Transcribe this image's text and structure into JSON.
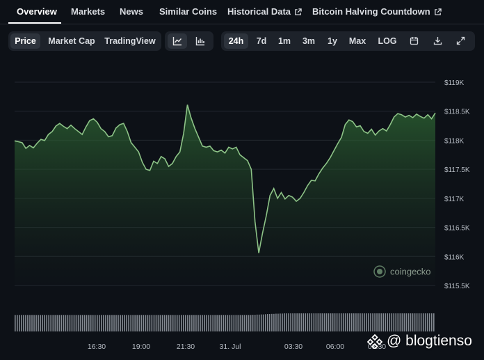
{
  "nav": {
    "tabs": [
      {
        "label": "Overview",
        "active": true,
        "external": false
      },
      {
        "label": "Markets",
        "active": false,
        "external": false
      },
      {
        "label": "News",
        "active": false,
        "external": false
      },
      {
        "label": "Similar Coins",
        "active": false,
        "external": false
      },
      {
        "label": "Historical Data",
        "active": false,
        "external": true
      },
      {
        "label": "Bitcoin Halving Countdown",
        "active": false,
        "external": true
      }
    ]
  },
  "toolbar": {
    "metric_tabs": [
      "Price",
      "Market Cap",
      "TradingView"
    ],
    "metric_selected": "Price",
    "chart_type_icons": [
      "line-chart-icon",
      "bar-chart-icon"
    ],
    "chart_type_selected": "line-chart-icon",
    "ranges": [
      "24h",
      "7d",
      "1m",
      "3m",
      "1y",
      "Max",
      "LOG"
    ],
    "range_selected": "24h",
    "action_icons": [
      "calendar-icon",
      "download-icon",
      "expand-icon"
    ]
  },
  "chart_data": {
    "type": "area",
    "x": [
      "14:05",
      "14:18",
      "14:30",
      "14:43",
      "14:55",
      "15:08",
      "15:20",
      "15:33",
      "15:45",
      "15:58",
      "16:10",
      "16:23",
      "16:35",
      "16:48",
      "17:00",
      "17:13",
      "17:25",
      "17:38",
      "17:50",
      "18:03",
      "18:15",
      "18:28",
      "18:40",
      "18:53",
      "19:05",
      "19:18",
      "19:30",
      "19:43",
      "19:55",
      "20:08",
      "20:20",
      "20:33",
      "20:45",
      "20:58",
      "21:10",
      "21:23",
      "21:35",
      "21:48",
      "22:00",
      "22:13",
      "22:25",
      "22:38",
      "22:50",
      "23:03",
      "23:15",
      "23:28",
      "23:40",
      "23:53",
      "00:05",
      "00:18",
      "00:30",
      "00:43",
      "00:55",
      "01:08",
      "01:20",
      "01:33",
      "01:45",
      "01:58",
      "02:10",
      "02:23",
      "02:35",
      "02:48",
      "03:00",
      "03:13",
      "03:25",
      "03:38",
      "03:50",
      "04:03",
      "04:15",
      "04:28",
      "04:40",
      "04:53",
      "05:05",
      "05:18",
      "05:30",
      "05:43",
      "05:55",
      "06:08",
      "06:20",
      "06:33",
      "06:45",
      "06:58",
      "07:10",
      "07:23",
      "07:35",
      "07:48",
      "08:00",
      "08:13",
      "08:25",
      "08:38",
      "08:50",
      "09:03",
      "09:15",
      "09:28",
      "09:40",
      "09:53",
      "10:05",
      "10:18",
      "10:30",
      "10:43",
      "10:55",
      "11:08",
      "11:20",
      "11:33"
    ],
    "values": [
      117990,
      117975,
      117960,
      117860,
      117910,
      117870,
      117950,
      118015,
      117995,
      118100,
      118150,
      118245,
      118290,
      118240,
      118200,
      118260,
      118200,
      118150,
      118100,
      118230,
      118340,
      118370,
      118310,
      118200,
      118150,
      118060,
      118080,
      118210,
      118270,
      118290,
      118150,
      117960,
      117880,
      117800,
      117620,
      117500,
      117480,
      117640,
      117600,
      117720,
      117680,
      117550,
      117600,
      117720,
      117800,
      118120,
      118610,
      118380,
      118200,
      118050,
      117900,
      117880,
      117900,
      117820,
      117800,
      117830,
      117780,
      117880,
      117850,
      117880,
      117750,
      117700,
      117650,
      117500,
      116600,
      116060,
      116400,
      116700,
      117050,
      117170,
      117000,
      117100,
      116990,
      117050,
      117020,
      116950,
      117000,
      117100,
      117220,
      117310,
      117300,
      117420,
      117520,
      117600,
      117700,
      117820,
      117940,
      118050,
      118270,
      118350,
      118320,
      118230,
      118250,
      118150,
      118120,
      118190,
      118090,
      118160,
      118200,
      118160,
      118270,
      118400,
      118460,
      118440,
      118400,
      118430,
      118390,
      118450,
      118410,
      118380,
      118440,
      118370,
      118470
    ],
    "ylim": [
      115500,
      119000
    ],
    "y_ticks": [
      "$119K",
      "$118.5K",
      "$118K",
      "$117.5K",
      "$117K",
      "$116.5K",
      "$116K",
      "$115.5K"
    ],
    "x_ticks": [
      "16:30",
      "19:00",
      "21:30",
      "31. Jul",
      "03:30",
      "06:00",
      "08:30"
    ],
    "volume": [
      0.91,
      0.91,
      0.91,
      0.91,
      0.91,
      0.91,
      0.91,
      0.91,
      0.91,
      0.91,
      0.91,
      0.91,
      0.91,
      0.91,
      0.91,
      0.91,
      0.91,
      0.91,
      0.91,
      0.91,
      0.91,
      0.91,
      0.91,
      0.91,
      0.91,
      0.91,
      0.91,
      0.91,
      0.91,
      0.91,
      0.91,
      0.91,
      0.91,
      0.91,
      0.91,
      0.91,
      0.91,
      0.91,
      0.91,
      0.91,
      0.91,
      0.91,
      0.91,
      0.91,
      0.91,
      0.91,
      0.91,
      0.91,
      0.91,
      0.91,
      0.91,
      0.91,
      0.91,
      0.91,
      0.91,
      0.91,
      0.91,
      0.91,
      0.91,
      0.91,
      0.91,
      0.91,
      0.91,
      0.91,
      0.92,
      0.93,
      0.94,
      0.95,
      0.96,
      0.97,
      0.98,
      0.99,
      1,
      1,
      1,
      1,
      1,
      1,
      1,
      1,
      1,
      1,
      1,
      1,
      1,
      1,
      1,
      1,
      1,
      1,
      1,
      1,
      1,
      1,
      1,
      1,
      1,
      1,
      1,
      1,
      1,
      1,
      1,
      1,
      1,
      1,
      1,
      1,
      1,
      1,
      1,
      1,
      1
    ],
    "line_color": "#8dc387",
    "volume_color": "#9aa0a8",
    "grid": true
  },
  "branding": {
    "chart_watermark": "coingecko",
    "overlay_text": "@ blogtienso"
  }
}
